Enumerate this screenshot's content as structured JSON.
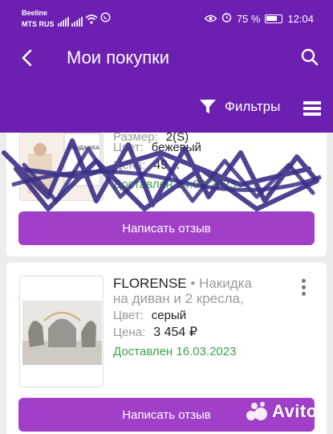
{
  "status_bar": {
    "carrier_line1": "Beeline",
    "carrier_line2": "MTS RUS",
    "battery_percent": "75 %",
    "time": "12:04"
  },
  "header": {
    "title": "Мои покупки",
    "filter_label": "Фильтры",
    "bg_color": "#6c1fb0"
  },
  "orders": [
    {
      "attr_size_label": "Размер:",
      "attr_size_value": "2(S)",
      "attr_color_label": "Цвет:",
      "attr_color_value": "бежевый",
      "attr_price_label": "Цена:",
      "attr_price_value": "49…",
      "delivered": "Доставлен 14.03.2023",
      "thumb_text": "БАНДАЖКА",
      "review_label": "Написать отзыв"
    },
    {
      "brand": "FLORENSE",
      "separator": " • ",
      "title": "Накидка на диван и 2 кресла,",
      "attr_color_label": "Цвет:",
      "attr_color_value": "серый",
      "attr_price_label": "Цена:",
      "attr_price_value": "3 454 ₽",
      "delivered": "Доставлен 16.03.2023",
      "review_label": "Написать отзыв"
    }
  ],
  "watermark": "Avito",
  "colors": {
    "accent": "#a13fc9",
    "delivered": "#3ea34b"
  }
}
